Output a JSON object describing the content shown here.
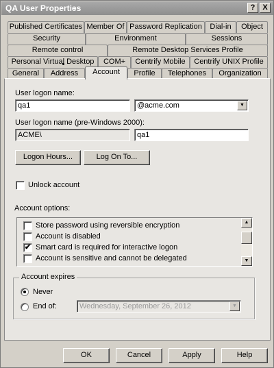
{
  "window": {
    "title": "QA User Properties",
    "help_glyph": "?",
    "close_glyph": "X"
  },
  "tabs": {
    "row1": [
      "Published Certificates",
      "Member Of",
      "Password Replication",
      "Dial-in",
      "Object"
    ],
    "row2": [
      "Security",
      "Environment",
      "Sessions"
    ],
    "row3": [
      "Remote control",
      "Remote Desktop Services Profile"
    ],
    "row4": [
      "Personal Virtual Desktop",
      "COM+",
      "Centrify Mobile",
      "Centrify UNIX Profile"
    ],
    "row5": [
      "General",
      "Address",
      "Account",
      "Profile",
      "Telephones",
      "Organization"
    ],
    "active": "Account"
  },
  "account": {
    "logon_name_label": "User logon name:",
    "logon_name_value": "qa1",
    "upn_suffix": "@acme.com",
    "pre2000_label": "User logon name (pre-Windows 2000):",
    "pre2000_domain": "ACME\\",
    "pre2000_user": "qa1",
    "logon_hours_button": "Logon Hours...",
    "log_on_to_button": "Log On To...",
    "unlock_label": "Unlock account",
    "unlock_checked": false,
    "options_label": "Account options:",
    "options": [
      {
        "label": "Store password using reversible encryption",
        "checked": false
      },
      {
        "label": "Account is disabled",
        "checked": false
      },
      {
        "label": "Smart card is required for interactive logon",
        "checked": true
      },
      {
        "label": "Account is sensitive and cannot be delegated",
        "checked": false
      }
    ],
    "expires": {
      "group_label": "Account expires",
      "never_label": "Never",
      "end_of_label": "End of:",
      "selected": "Never",
      "end_date": "Wednesday,  September 26, 2012"
    }
  },
  "footer": {
    "ok": "OK",
    "cancel": "Cancel",
    "apply": "Apply",
    "help": "Help"
  },
  "icons": {
    "check": "✔",
    "down_arrow": "▼",
    "up_arrow": "▲"
  }
}
